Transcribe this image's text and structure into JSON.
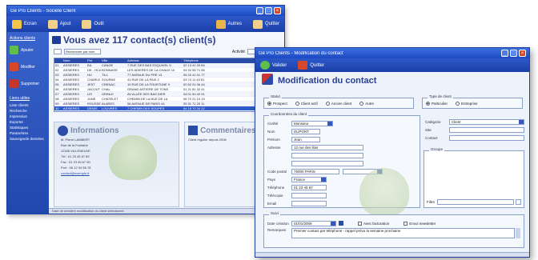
{
  "back_window": {
    "title": "Gé Pro Clients - Société Client",
    "toolbar": {
      "buttons": [
        {
          "label": "Ecran",
          "icon": "home-icon"
        },
        {
          "label": "Ajout",
          "icon": "folder-add-icon"
        },
        {
          "label": "Outil",
          "icon": "folder-icon"
        }
      ],
      "right_buttons": [
        {
          "label": "Autres",
          "icon": "truck-icon"
        },
        {
          "label": "Quitter",
          "icon": "folder-exit-icon"
        }
      ]
    },
    "sidebar": {
      "heading": "Actions clients",
      "actions": [
        {
          "label": "Ajouter",
          "icon": "add-user-icon"
        },
        {
          "label": "Modifier",
          "icon": "edit-user-icon"
        },
        {
          "label": "Supprimer",
          "icon": "delete-user-icon"
        }
      ],
      "links_heading": "Liens utiles",
      "links": [
        "Liste clients",
        "Recherche",
        "Impression",
        "Exporter",
        "Statistiques",
        "Paramètres",
        "Sauvegarde données"
      ]
    },
    "main": {
      "title": "Vous avez 117 contact(s) client(s)",
      "filter_label": "Rechercher par nom",
      "filter2_label": "Activité",
      "grid_headers": [
        "",
        "Nom",
        "Pré.",
        "Ville",
        "Adresse",
        "Téléphone"
      ],
      "grid_rows": [
        [
          "01",
          "ASSIERES",
          "BIL",
          "CANGE",
          "7 RUE DES BAS ESQUIVEL 5",
          "02 13 41 09 84"
        ],
        [
          "02",
          "ASSIERES",
          "DE - HCA",
          "BONNAGE",
          "LES ADIERES DE LA CHAUX 10",
          "04 92 55 71 56"
        ],
        [
          "03",
          "ASSIERES",
          "HU",
          "TILL",
          "77 AVENUE DU PRÉ 13",
          "05 20 41 01 77"
        ],
        [
          "04",
          "ASSIERES",
          "CHARLE",
          "SOURNE",
          "41 RUE DE LA PAIX 2",
          "03 74 11 40 51"
        ],
        [
          "05",
          "ASSIERES",
          "JEST",
          "CRENAC",
          "10 RUE DE LA FOURTUNE 9",
          "02 62 01 06 44"
        ],
        [
          "06",
          "ASSIERES",
          "JACOUT",
          "CHAL",
          "GRAND ASTIERE DE TONS",
          "01 21 81 32 41"
        ],
        [
          "07",
          "ASSIERES",
          "LEI",
          "GRINLE",
          "AV ALLÉE DES BAS DIER",
          "04 01 50 40 91"
        ],
        [
          "08",
          "ASSIERES",
          "JUNE",
          "CHATELET",
          "CHEMIN DE LA NUE DE LA",
          "06 70 21 10 15"
        ],
        [
          "09",
          "ASSIERES",
          "ROUSSE",
          "ALARES",
          "56 AVENUE DE PARIS 44",
          "05 31 71 20 11"
        ],
        [
          "10",
          "ASSIERES",
          "DEMIS",
          "LOUVRES",
          "7 CHEMIN DES SOUPES",
          "04 15 70 34 12"
        ]
      ],
      "info_title": "Informations",
      "info_lines": [
        "M. Pierre LAMBERT",
        "Rue de la Fontaine",
        "12345 VILLENEUVE",
        "Tél : 01 23 45 67 89",
        "Fax : 01 23 45 67 90",
        "Port : 06 12 34 56 78",
        "contact@exemple.fr"
      ],
      "comment_title": "Commentaires",
      "comment_text": "Client régulier depuis 2008",
      "status": "Date de dernière modification du client sélectionné"
    }
  },
  "front_window": {
    "title": "Gé Pro Clients - Modification du contact",
    "toolbar": {
      "buttons": [
        {
          "label": "Valider",
          "icon": "check-icon"
        },
        {
          "label": "Quitter",
          "icon": "exit-icon"
        }
      ]
    },
    "heading": "Modification du contact",
    "type_section": {
      "label": "Statut",
      "options": [
        {
          "label": "Prospect",
          "selected": true
        },
        {
          "label": "Client actif",
          "selected": false
        },
        {
          "label": "Ancien client",
          "selected": false
        },
        {
          "label": "Autre",
          "selected": false
        }
      ]
    },
    "kind_section": {
      "label": "Type de client",
      "options": [
        {
          "label": "Particulier",
          "selected": true
        },
        {
          "label": "Entreprise",
          "selected": false
        }
      ]
    },
    "identity_section": {
      "label": "Coordonnées du client",
      "fields": [
        {
          "label": "Civilité",
          "value": "Monsieur"
        },
        {
          "label": "Nom",
          "value": "DUPONT"
        },
        {
          "label": "Prénom",
          "value": "Jean"
        },
        {
          "label": "Adresse",
          "value": "12 rue des lilas"
        },
        {
          "label": "",
          "value": ""
        },
        {
          "label": "",
          "value": ""
        },
        {
          "label": "Code postal",
          "value": "75000 PARIS"
        },
        {
          "label": "Pays",
          "value": "France"
        },
        {
          "label": "Téléphone",
          "value": "01 23 45 67"
        },
        {
          "label": "Télécopie",
          "value": ""
        },
        {
          "label": "Email",
          "value": ""
        }
      ]
    },
    "right_fields": [
      {
        "label": "Catégorie",
        "value": "Client"
      },
      {
        "label": "Site",
        "value": ""
      },
      {
        "label": "Contact",
        "value": ""
      }
    ],
    "group_section": {
      "label": "Groupe",
      "footer_label": "Filtre"
    },
    "bottom_section": {
      "label": "Suivi",
      "date_label": "Date création",
      "date_value": "01/01/2009",
      "check1": "Avec facturation",
      "check2": "Envoi newsletter",
      "notes_label": "Remarques",
      "notes_value": "Premier contact par téléphone - rappel prévu la semaine prochaine"
    }
  },
  "colors": {
    "accent": "#1d49c2",
    "title_text": "#2a3f8f",
    "close_button": "#d9472b"
  }
}
